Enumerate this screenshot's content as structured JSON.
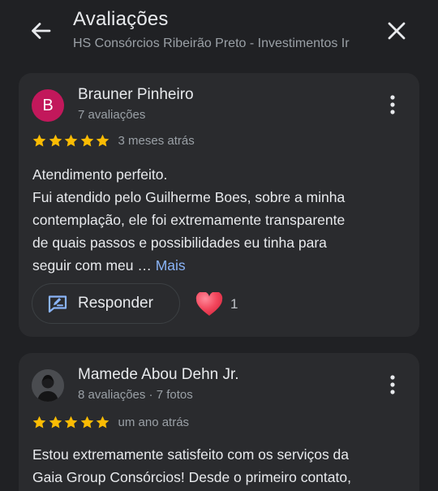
{
  "header": {
    "title": "Avaliações",
    "subtitle": "HS Consórcios Ribeirão Preto - Investimentos Ir"
  },
  "icons": {
    "back": "arrow-left-icon",
    "close": "close-icon",
    "more": "more-vert-icon",
    "star": "star-icon",
    "reply": "reply-edit-icon",
    "like": "heart-icon"
  },
  "colors": {
    "background": "#202124",
    "card": "#2a2b2e",
    "star": "#fbbc04",
    "link": "#8ab4f8",
    "avatar": "#c2185b",
    "heart": "#f2465c"
  },
  "reviews": [
    {
      "avatar_letter": "B",
      "name": "Brauner Pinheiro",
      "meta": "7 avaliações",
      "rating": 5,
      "date": "3 meses atrás",
      "text_lines": [
        "Atendimento perfeito.",
        "Fui atendido pelo Guilherme Boes, sobre a minha",
        "contemplação, ele foi extremamente transparente",
        "de quais passos e possibilidades eu tinha para",
        "seguir com meu … "
      ],
      "more_label": "Mais",
      "reply_label": "Responder",
      "like_count": "1"
    },
    {
      "name": "Mamede Abou Dehn Jr.",
      "meta": "8 avaliações · 7 fotos",
      "rating": 5,
      "date": "um ano atrás",
      "text_lines": [
        "Estou extremamente satisfeito com os serviços da",
        "Gaia Group Consórcios! Desde o primeiro contato,"
      ]
    }
  ]
}
